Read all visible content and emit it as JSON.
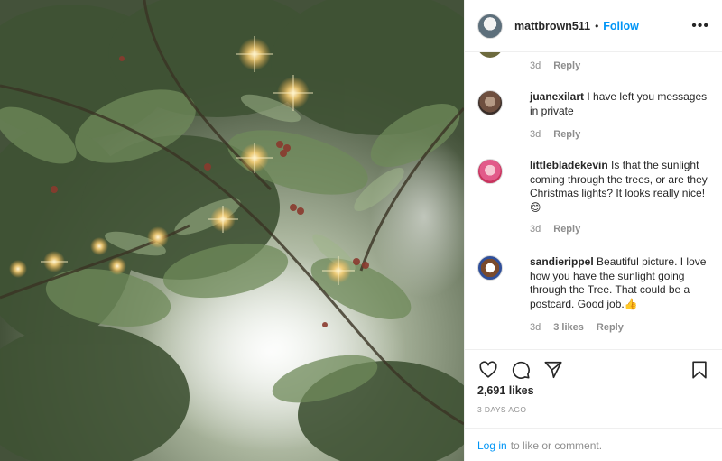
{
  "post": {
    "username": "mattbrown511",
    "separator": "•",
    "follow_label": "Follow",
    "more_label": "•••"
  },
  "partial_comment": {
    "time": "3d",
    "reply_label": "Reply"
  },
  "comments": [
    {
      "username": "juanexilart",
      "text": "I have left you messages in private",
      "time": "3d",
      "reply_label": "Reply",
      "likes": ""
    },
    {
      "username": "littlebladekevin",
      "text": "Is that the sunlight coming through the trees, or are they Christmas lights? It looks really nice!",
      "emoji": "😊",
      "time": "3d",
      "reply_label": "Reply",
      "likes": ""
    },
    {
      "username": "sandierippel",
      "text": "Beautiful picture. I love how you have the sunlight going through the Tree. That could be a postcard. Good job.",
      "emoji": "👍",
      "time": "3d",
      "reply_label": "Reply",
      "likes": "3 likes"
    }
  ],
  "actions": {
    "icons": [
      "heart-icon",
      "comment-icon",
      "share-icon",
      "bookmark-icon"
    ],
    "likes_count": "2,691 likes",
    "date": "3 DAYS AGO"
  },
  "login": {
    "link_label": "Log in",
    "rest_text": "to like or comment."
  },
  "colors": {
    "link_blue": "#0095f6",
    "secondary_text": "#8e8e8e",
    "primary_text": "#262626",
    "divider": "#efefef"
  }
}
